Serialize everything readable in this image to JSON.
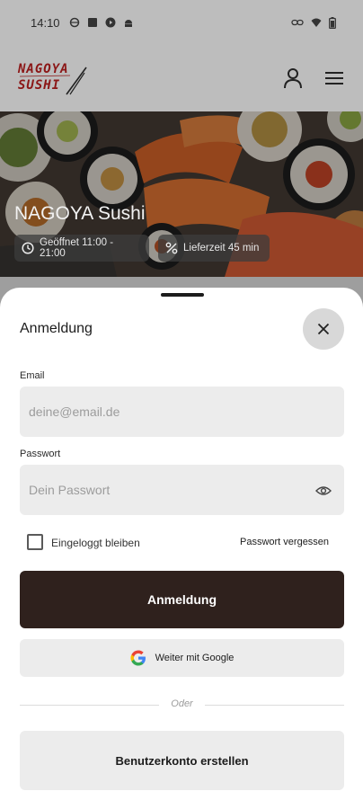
{
  "status_bar": {
    "time": "14:10",
    "left_icons": [
      "circle-icon",
      "square-icon",
      "play-circle-icon",
      "android-icon"
    ],
    "right_icons": [
      "link-icon",
      "wifi-icon",
      "battery-icon"
    ]
  },
  "header": {
    "logo_line1": "NAGOYA",
    "logo_line2": "SUSHI",
    "icons": [
      "user-icon",
      "menu-icon"
    ]
  },
  "hero": {
    "title": "NAGOYA Sushi",
    "open_hours": "Geöffnet 11:00 - 21:00",
    "delivery_time": "Lieferzeit 45 min"
  },
  "login_sheet": {
    "title": "Anmeldung",
    "email_label": "Email",
    "email_placeholder": "deine@email.de",
    "email_value": "",
    "password_label": "Passwort",
    "password_placeholder": "Dein Passwort",
    "password_value": "",
    "remember_label": "Eingeloggt bleiben",
    "remember_checked": false,
    "forgot_label": "Passwort vergessen",
    "submit_label": "Anmeldung",
    "google_label": "Weiter mit Google",
    "divider_label": "Oder",
    "register_label": "Benutzerkonto erstellen"
  },
  "colors": {
    "primary_button": "#2f211d",
    "logo": "#8b1616",
    "field_bg": "#ececec"
  }
}
